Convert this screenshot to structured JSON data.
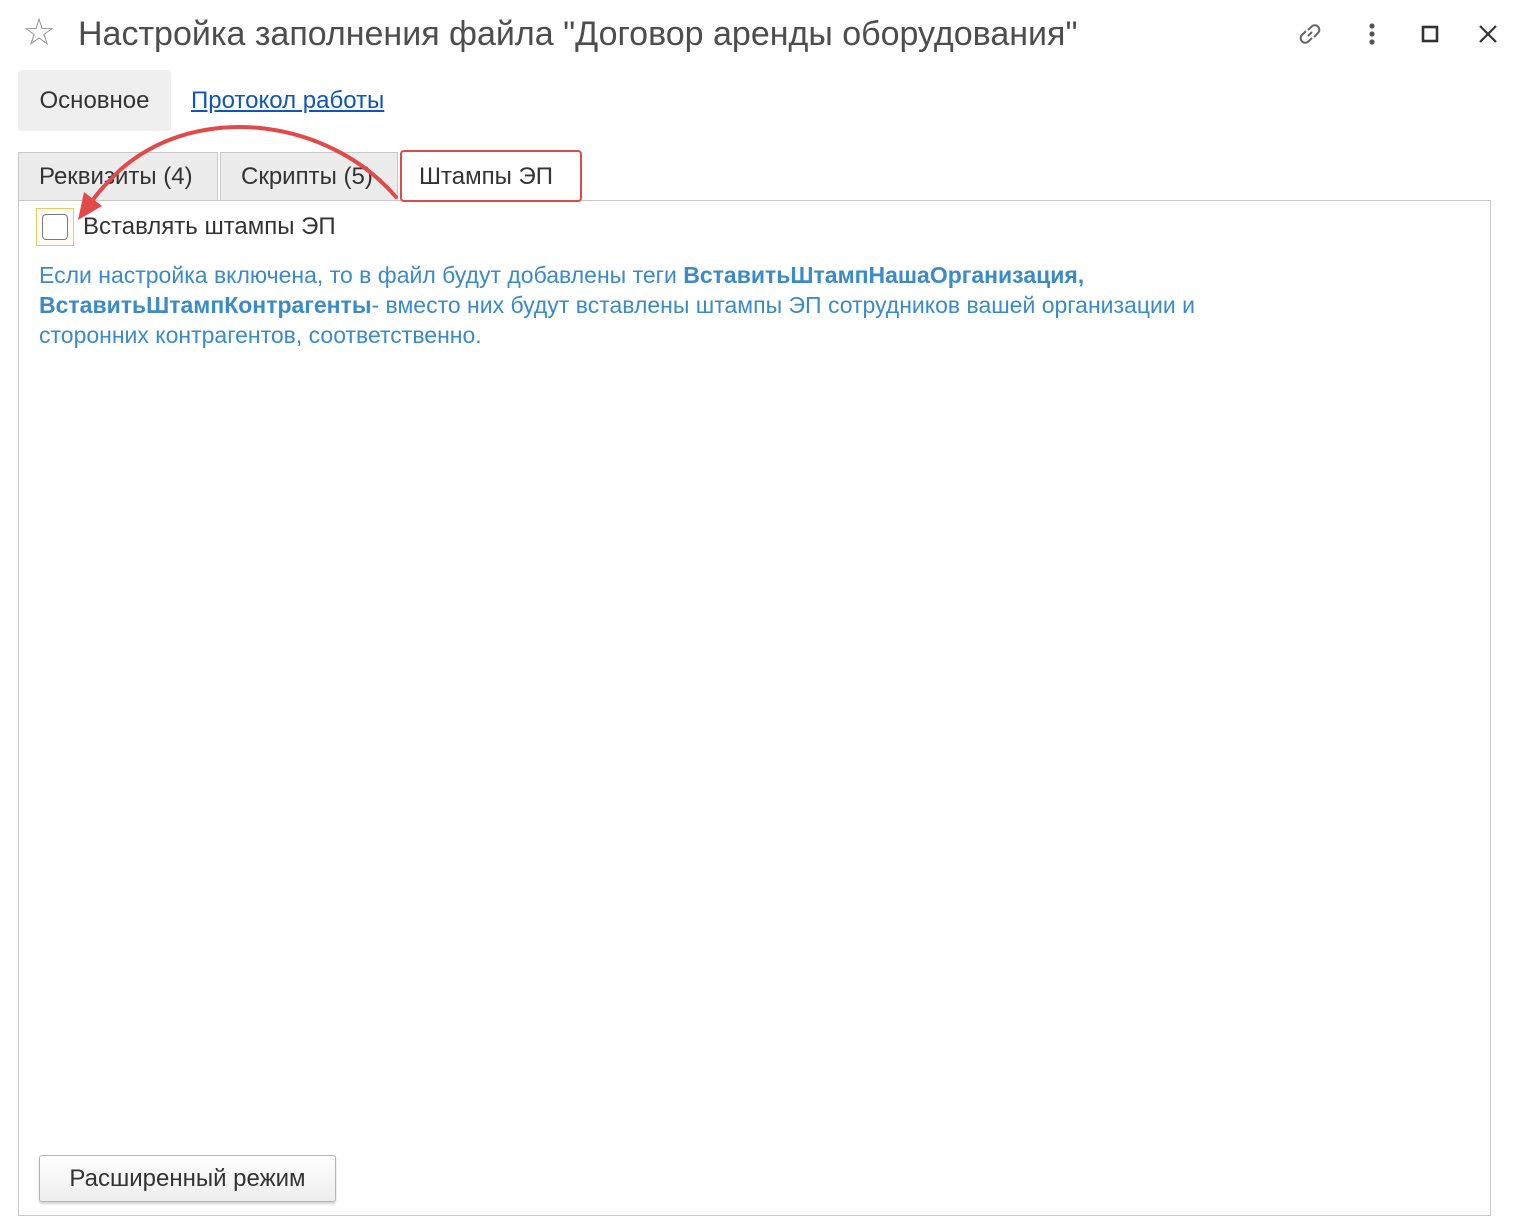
{
  "window": {
    "title": "Настройка заполнения файла \"Договор аренды оборудования\"",
    "star_icon": "star-outline-icon",
    "toolbar_icons": [
      "link-icon",
      "more-vertical-icon",
      "maximize-icon",
      "close-icon"
    ]
  },
  "command_tabs": {
    "main_label": "Основное",
    "log_label": "Протокол работы"
  },
  "tabs": [
    {
      "label": "Реквизиты (4)",
      "selected": false
    },
    {
      "label": "Скрипты (5)",
      "selected": false
    },
    {
      "label": "Штампы ЭП",
      "selected": true
    }
  ],
  "content": {
    "checkbox_label": "Вставлять штампы ЭП",
    "checkbox_checked": false,
    "info_part1": "Если настройка включена, то в файл будут добавлены теги ",
    "info_bold1": "ВставитьШтампНашаОрганизация,",
    "info_bold2": "ВставитьШтампКонтрагенты",
    "info_part2": "- вместо них будут вставлены штампы ЭП сотрудников вашей организации и сторонних контрагентов, соответственно.",
    "advanced_button": "Расширенный режим"
  },
  "colors": {
    "info_text": "#3a8bc8",
    "link": "#0f57b6",
    "annotation_red": "#e24a4a",
    "checkbox_focus": "#e7c96a"
  }
}
